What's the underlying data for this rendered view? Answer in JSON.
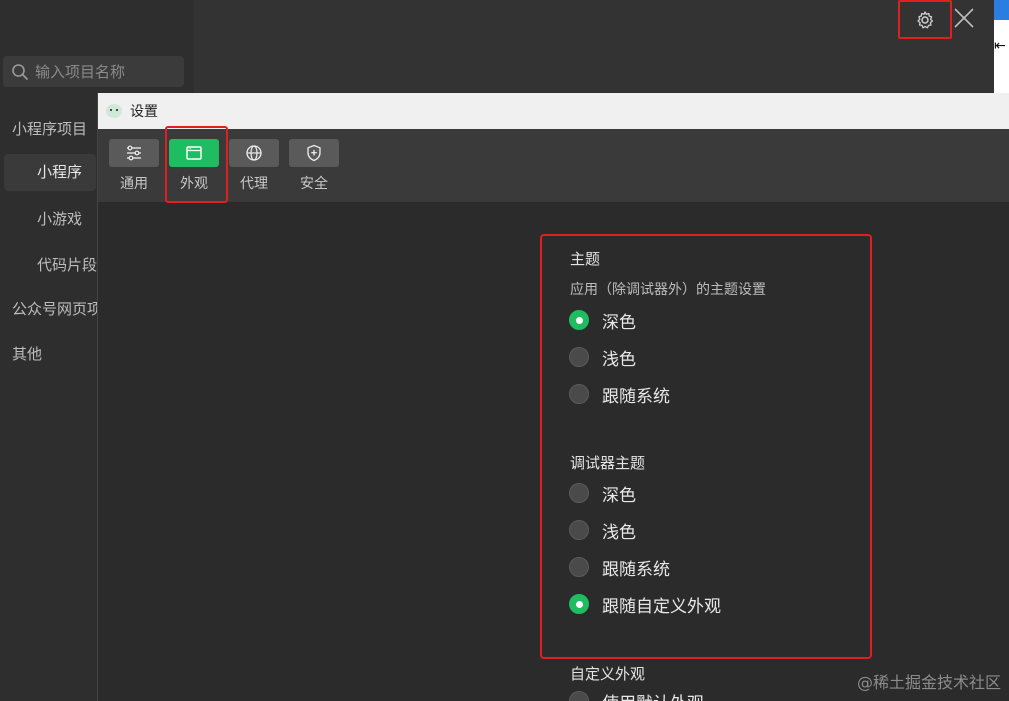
{
  "background_app": {
    "search": {
      "placeholder": "输入项目名称"
    },
    "sidebar": {
      "items": [
        {
          "label": "小程序项目"
        },
        {
          "label": "小程序"
        },
        {
          "label": "小游戏"
        },
        {
          "label": "代码片段"
        },
        {
          "label": "公众号网页项目"
        },
        {
          "label": "其他"
        }
      ]
    }
  },
  "settings": {
    "title": "设置",
    "tabs": [
      {
        "label": "通用",
        "icon": "sliders-icon"
      },
      {
        "label": "外观",
        "icon": "window-icon"
      },
      {
        "label": "代理",
        "icon": "globe-icon"
      },
      {
        "label": "安全",
        "icon": "shield-plus-icon"
      }
    ],
    "active_tab": "外观",
    "theme": {
      "title": "主题",
      "desc": "应用（除调试器外）的主题设置",
      "options": [
        {
          "label": "深色",
          "checked": true
        },
        {
          "label": "浅色",
          "checked": false
        },
        {
          "label": "跟随系统",
          "checked": false
        }
      ]
    },
    "debugger_theme": {
      "title": "调试器主题",
      "options": [
        {
          "label": "深色",
          "checked": false
        },
        {
          "label": "浅色",
          "checked": false
        },
        {
          "label": "跟随系统",
          "checked": false
        },
        {
          "label": "跟随自定义外观",
          "checked": true
        }
      ]
    },
    "custom_appearance": {
      "title": "自定义外观",
      "options": [
        {
          "label": "使用默认外观",
          "checked": false
        }
      ]
    }
  },
  "watermark": "@稀土掘金技术社区",
  "colors": {
    "accent_green": "#1fbc62",
    "highlight_red": "#e02020"
  }
}
